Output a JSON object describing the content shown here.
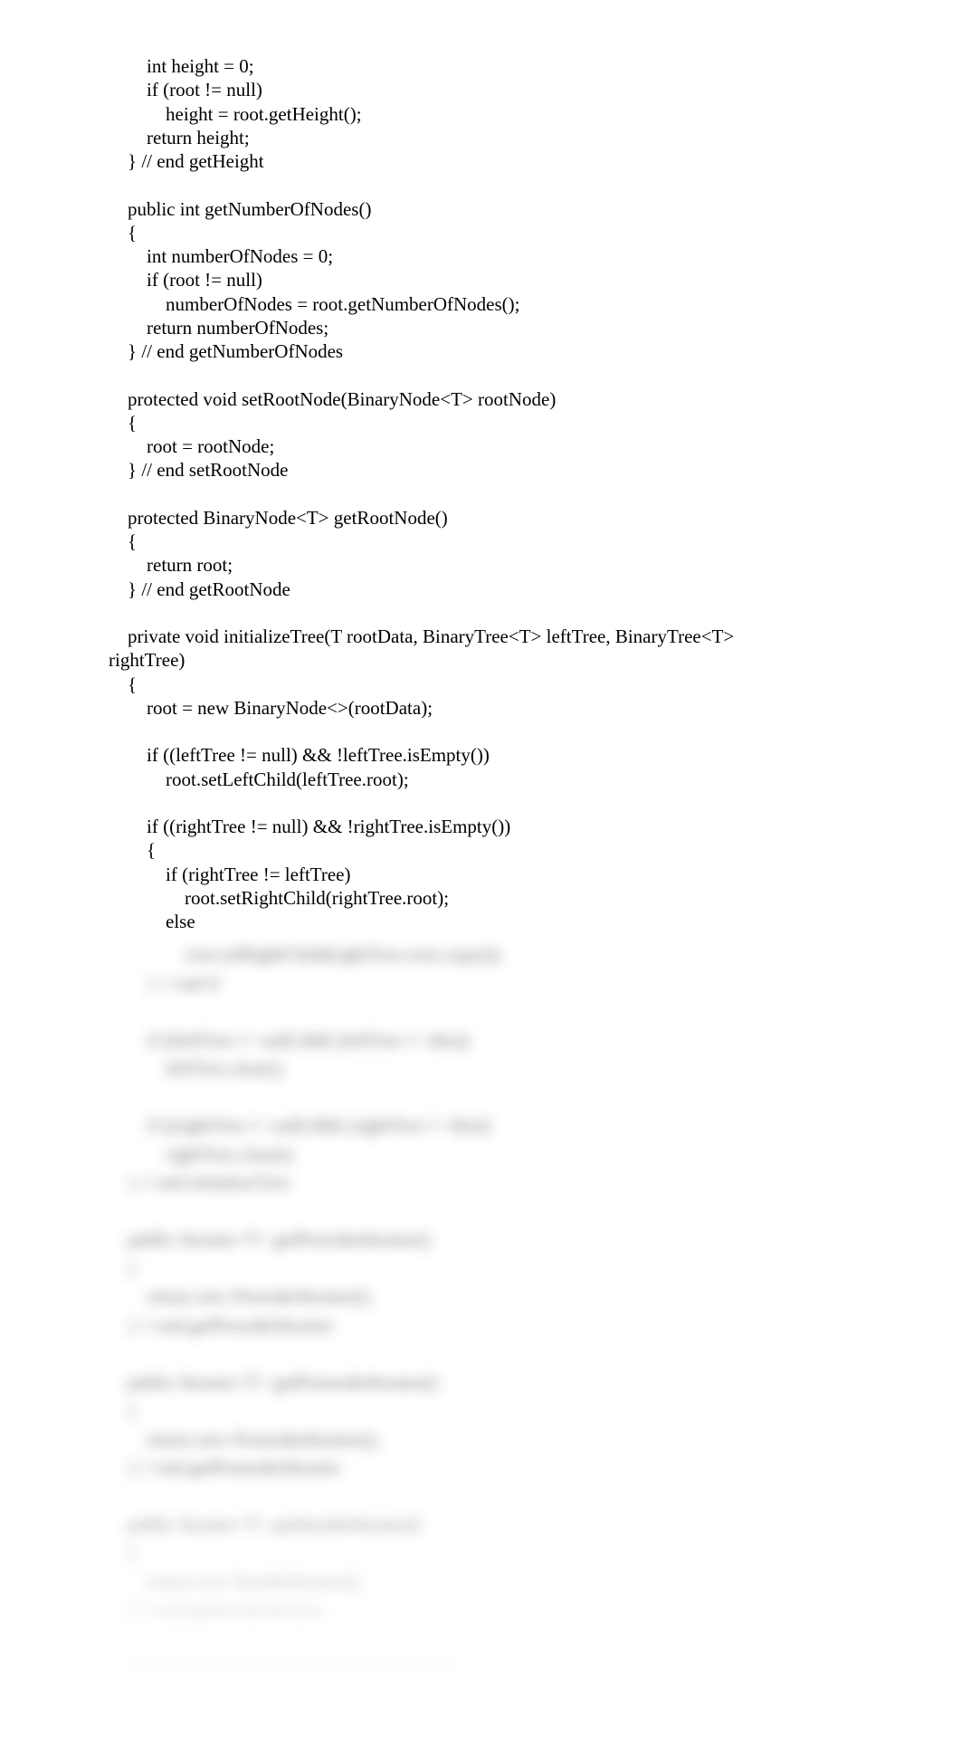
{
  "code_lines": [
    "        int height = 0;",
    "        if (root != null)",
    "            height = root.getHeight();",
    "        return height;",
    "    } // end getHeight",
    "",
    "    public int getNumberOfNodes()",
    "    {",
    "        int numberOfNodes = 0;",
    "        if (root != null)",
    "            numberOfNodes = root.getNumberOfNodes();",
    "        return numberOfNodes;",
    "    } // end getNumberOfNodes",
    "",
    "    protected void setRootNode(BinaryNode<T> rootNode)",
    "    {",
    "        root = rootNode;",
    "    } // end setRootNode",
    "",
    "    protected BinaryNode<T> getRootNode()",
    "    {",
    "        return root;",
    "    } // end getRootNode",
    "",
    "    private void initializeTree(T rootData, BinaryTree<T> leftTree, BinaryTree<T>",
    "rightTree)",
    "    {",
    "        root = new BinaryNode<>(rootData);",
    "",
    "        if ((leftTree != null) && !leftTree.isEmpty())",
    "            root.setLeftChild(leftTree.root);",
    "",
    "        if ((rightTree != null) && !rightTree.isEmpty())",
    "        {",
    "            if (rightTree != leftTree)",
    "                root.setRightChild(rightTree.root);",
    "            else"
  ],
  "blurred_lines": [
    "                root.setRightChild(rightTree.root.copy());",
    "        } // end if",
    "",
    "        if ((leftTree != null) && (leftTree != this))",
    "            leftTree.clear();",
    "",
    "        if ((rightTree != null) && (rightTree != this))",
    "            rightTree.clear();",
    "    } // end initializeTree",
    "",
    "    public Iterator<T> getPreorderIterator()",
    "    {",
    "        return new PreorderIterator();",
    "    } // end getPreorderIterator",
    "",
    "    public Iterator<T> getPostorderIterator()",
    "    {",
    "        return new PostorderIterator();",
    "    } // end getPostorderIterator",
    "",
    "    public Iterator<T> getInorderIterator()",
    "    {",
    "        return new InorderIterator();",
    "    } // end getInorderIterator",
    "",
    "    public Iterator<T> getLevelOrderIterator()",
    "    {"
  ]
}
